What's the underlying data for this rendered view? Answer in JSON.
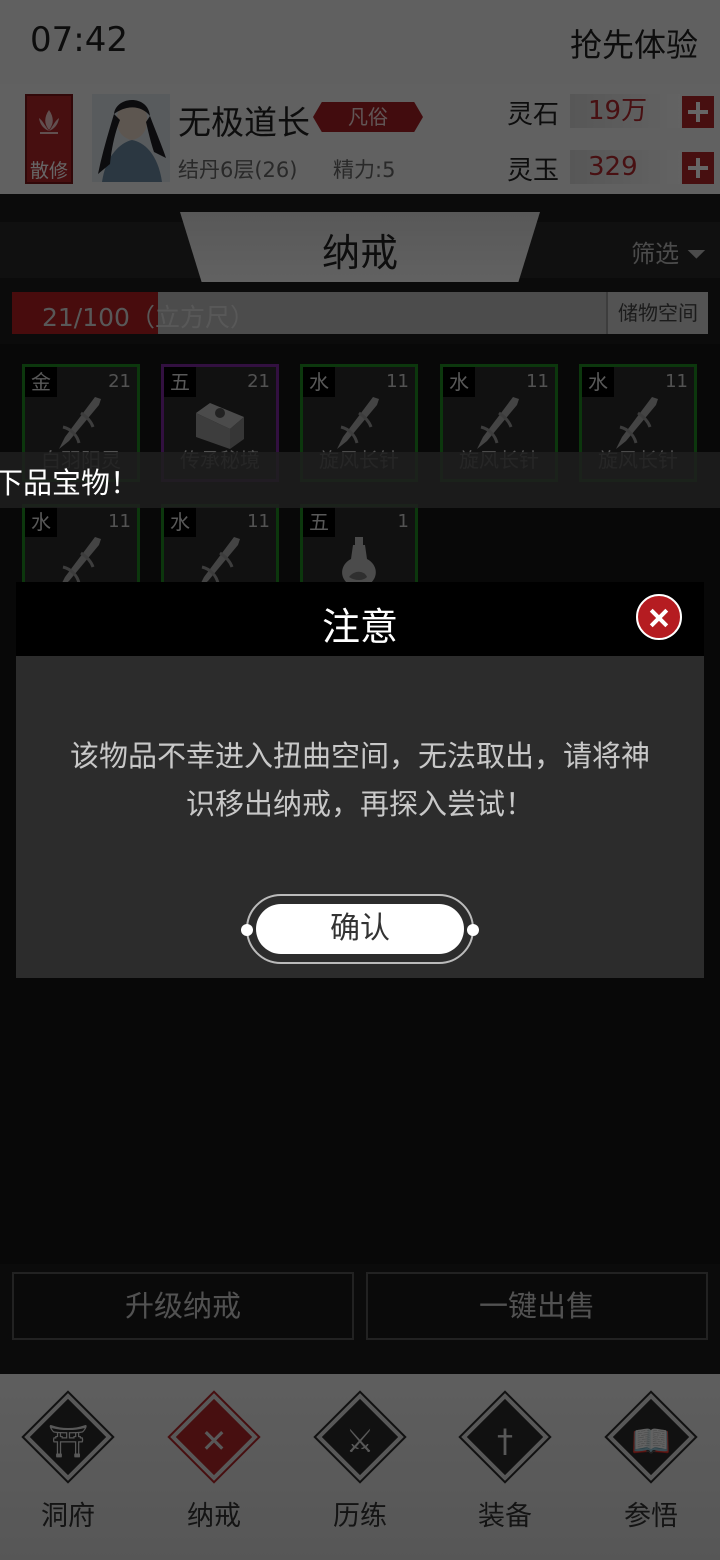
{
  "status_bar": {
    "time": "07:42",
    "promo": "抢先体验"
  },
  "player": {
    "sect": "散修",
    "name": "无极道长",
    "rank": "凡俗",
    "realm": "结丹6层(26)",
    "energy": "精力:5"
  },
  "resources": [
    {
      "label": "灵石",
      "value": "19万"
    },
    {
      "label": "灵玉",
      "value": "329"
    }
  ],
  "panel": {
    "title": "纳戒",
    "filter_label": "筛选",
    "capacity_text": "21/100（立方尺）",
    "capacity_used": 21,
    "capacity_total": 100,
    "storage_button": "储物空间"
  },
  "items": [
    {
      "element": "金",
      "level": "21",
      "name": "白羽阳灵",
      "rarity_color": "#1f8a22",
      "icon": "needle-icon"
    },
    {
      "element": "五",
      "level": "21",
      "name": "传承秘境",
      "rarity_color": "#7d2aa1",
      "icon": "scroll-map-icon"
    },
    {
      "element": "水",
      "level": "11",
      "name": "旋风长针",
      "rarity_color": "#1f8a22",
      "icon": "needle-icon"
    },
    {
      "element": "水",
      "level": "11",
      "name": "旋风长针",
      "rarity_color": "#1f8a22",
      "icon": "needle-icon"
    },
    {
      "element": "水",
      "level": "11",
      "name": "旋风长针",
      "rarity_color": "#1f8a22",
      "icon": "needle-icon"
    },
    {
      "element": "水",
      "level": "11",
      "name": "",
      "rarity_color": "#1f8a22",
      "icon": "needle-icon"
    },
    {
      "element": "水",
      "level": "11",
      "name": "",
      "rarity_color": "#1f8a22",
      "icon": "needle-icon"
    },
    {
      "element": "五",
      "level": "1",
      "name": "",
      "rarity_color": "#1f8a22",
      "icon": "gourd-icon"
    }
  ],
  "marquee": "下品宝物！",
  "actions": {
    "upgrade": "升级纳戒",
    "sell_all": "一键出售"
  },
  "nav": [
    {
      "label": "洞府",
      "icon": "cave-gate-icon"
    },
    {
      "label": "纳戒",
      "icon": "ring-storage-icon"
    },
    {
      "label": "历练",
      "icon": "crossed-swords-icon"
    },
    {
      "label": "装备",
      "icon": "dagger-icon"
    },
    {
      "label": "参悟",
      "icon": "open-book-icon"
    }
  ],
  "dialog": {
    "title": "注意",
    "message": "该物品不幸进入扭曲空间，无法取出，请将神识移出纳戒，再探入尝试！",
    "confirm": "确认"
  },
  "colors": {
    "accent": "#b2262a",
    "green_rarity": "#1f8a22",
    "purple_rarity": "#7d2aa1"
  }
}
